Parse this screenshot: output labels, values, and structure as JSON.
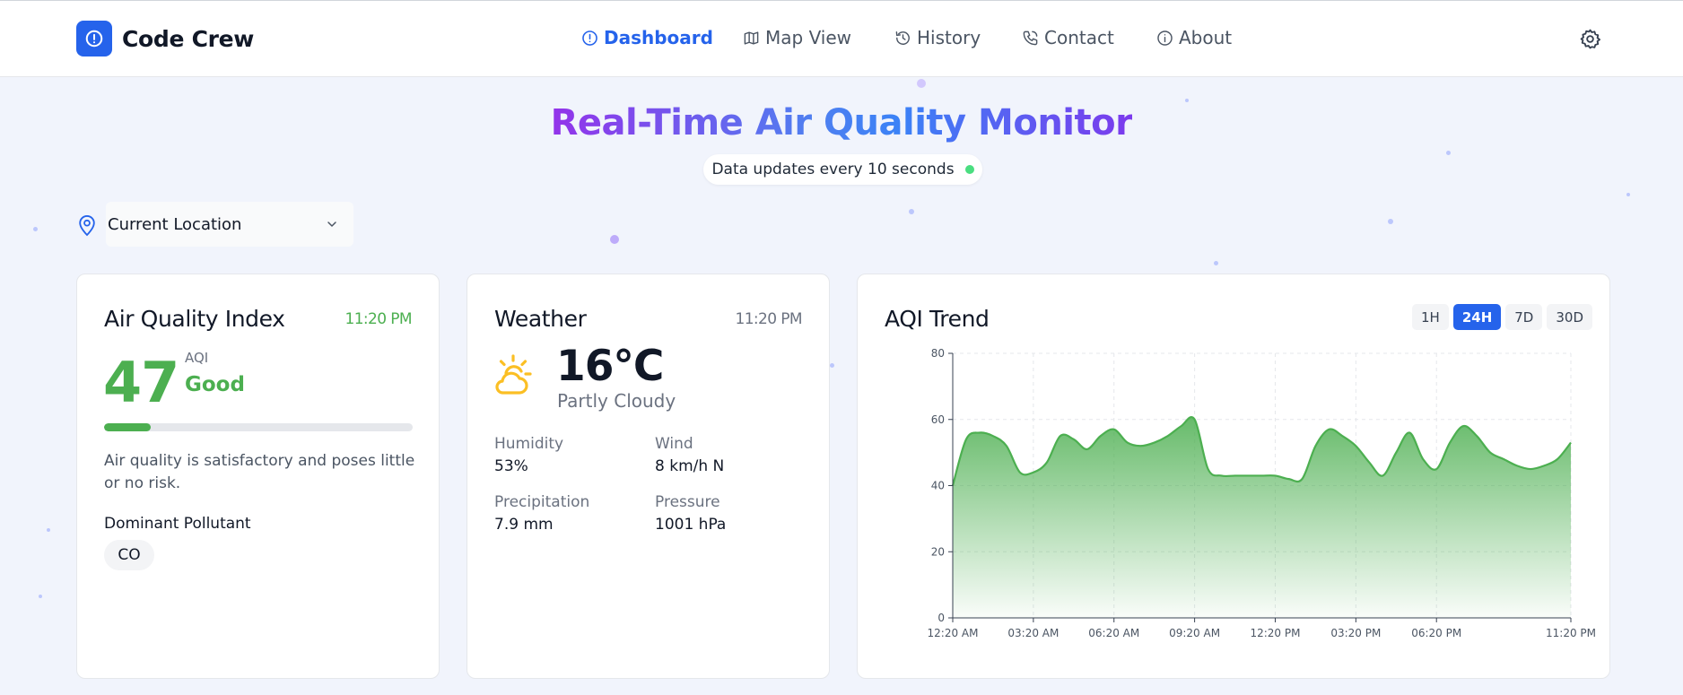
{
  "app": {
    "name": "Code Crew"
  },
  "nav": [
    {
      "label": "Dashboard",
      "icon": "alert-circle-icon",
      "active": true
    },
    {
      "label": "Map View",
      "icon": "map-icon",
      "active": false
    },
    {
      "label": "History",
      "icon": "history-icon",
      "active": false
    },
    {
      "label": "Contact",
      "icon": "phone-icon",
      "active": false
    },
    {
      "label": "About",
      "icon": "info-icon",
      "active": false
    }
  ],
  "hero": {
    "title": "Real-Time Air Quality Monitor",
    "update_text": "Data updates every 10 seconds"
  },
  "location": {
    "selected": "Current Location"
  },
  "aqi_card": {
    "title": "Air Quality Index",
    "time": "11:20 PM",
    "value": "47",
    "label": "AQI",
    "category": "Good",
    "level_percent": 15,
    "description": "Air quality is satisfactory and poses little or no risk.",
    "pollutant_label": "Dominant Pollutant",
    "pollutant": "CO"
  },
  "weather_card": {
    "title": "Weather",
    "time": "11:20 PM",
    "temperature": "16°C",
    "condition": "Partly Cloudy",
    "icon": "partly-cloudy-icon",
    "stats": {
      "humidity_label": "Humidity",
      "humidity": "53%",
      "wind_label": "Wind",
      "wind": "8 km/h N",
      "precip_label": "Precipitation",
      "precip": "7.9 mm",
      "pressure_label": "Pressure",
      "pressure": "1001 hPa"
    }
  },
  "trend_card": {
    "title": "AQI Trend",
    "ranges": [
      "1H",
      "24H",
      "7D",
      "30D"
    ],
    "active_range": "24H"
  },
  "colors": {
    "primary": "#2563eb",
    "good": "#4caf50",
    "time_good": "#4caf50",
    "time_neutral": "#6b7280",
    "live": "#4ade80"
  },
  "chart_data": {
    "type": "area",
    "title": "",
    "xlabel": "",
    "ylabel": "",
    "x_ticks": [
      "12:20 AM",
      "03:20 AM",
      "06:20 AM",
      "09:20 AM",
      "12:20 PM",
      "03:20 PM",
      "06:20 PM",
      "11:20 PM"
    ],
    "x_tick_hours": [
      0,
      3,
      6,
      9,
      12,
      15,
      18,
      23
    ],
    "ylim": [
      0,
      80
    ],
    "y_ticks": [
      0,
      20,
      40,
      60,
      80
    ],
    "grid": true,
    "series": [
      {
        "x": [
          0,
          0.5,
          1,
          1.5,
          2,
          2.5,
          3,
          3.5,
          4,
          4.5,
          5,
          5.5,
          6,
          6.5,
          7,
          7.5,
          8,
          8.5,
          9,
          9.5,
          10,
          10.5,
          11,
          11.5,
          12,
          12.5,
          13,
          13.5,
          14,
          14.5,
          15,
          15.5,
          16,
          16.5,
          17,
          17.5,
          18,
          18.5,
          19,
          19.5,
          20,
          20.5,
          21,
          21.5,
          22,
          22.5,
          23
        ],
        "values": [
          40,
          54,
          56,
          55,
          52,
          44,
          44,
          47,
          55,
          54,
          51,
          55,
          57,
          53,
          52,
          53,
          55,
          58,
          60,
          45,
          43,
          43,
          43,
          43,
          43,
          42,
          42,
          52,
          57,
          55,
          52,
          47,
          43,
          50,
          56,
          48,
          45,
          53,
          58,
          55,
          50,
          48,
          46,
          45,
          46,
          48,
          53
        ]
      }
    ]
  }
}
